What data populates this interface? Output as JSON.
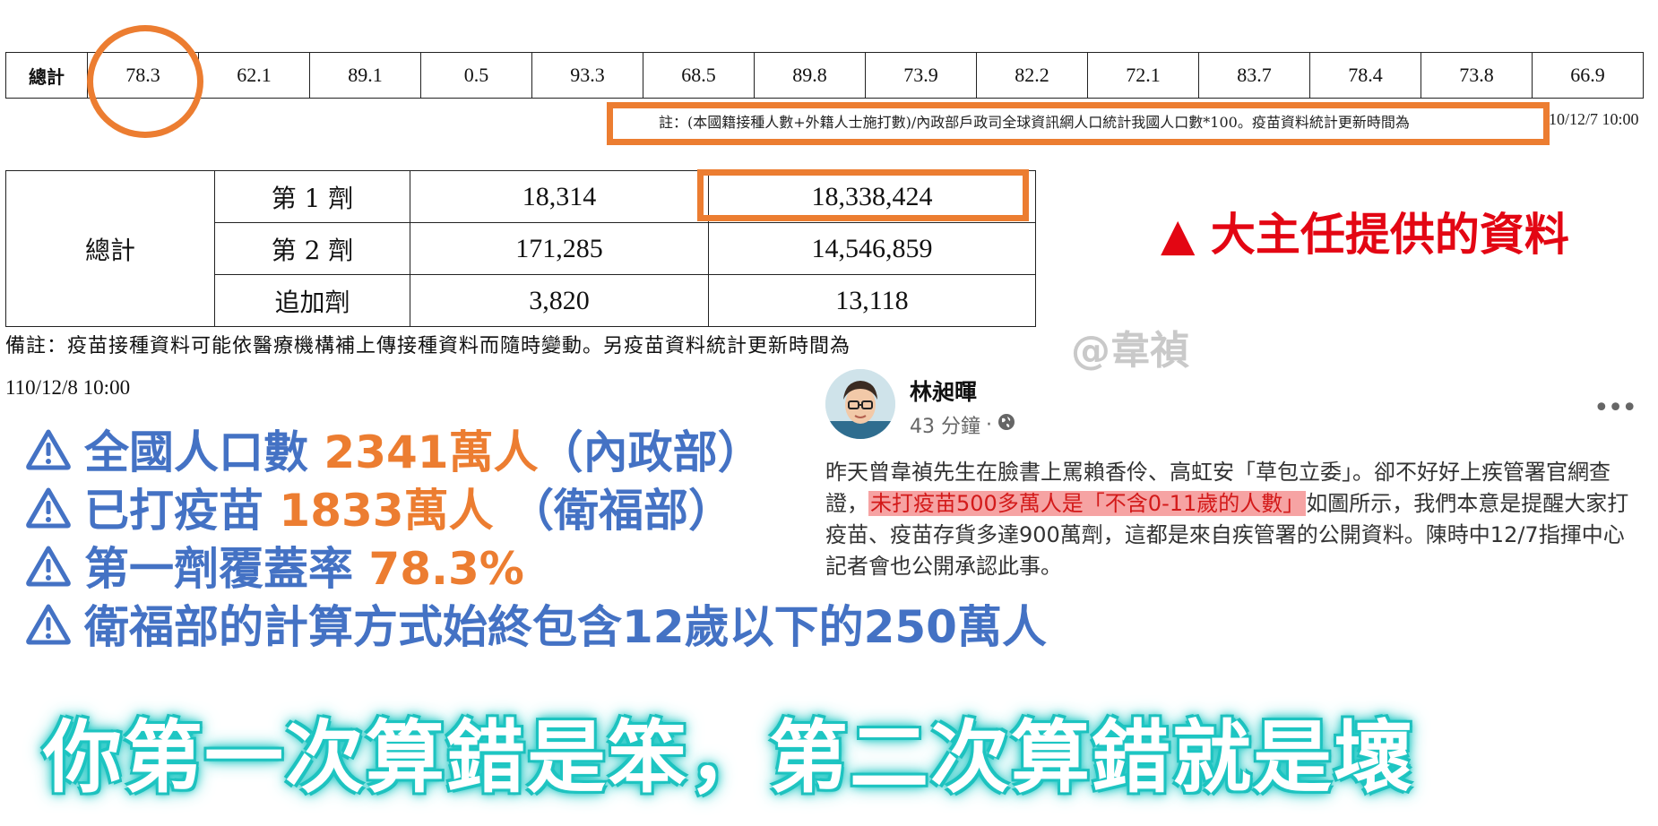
{
  "top_table": {
    "label": "總計",
    "values": [
      "78.3",
      "62.1",
      "89.1",
      "0.5",
      "93.3",
      "68.5",
      "89.8",
      "73.9",
      "82.2",
      "72.1",
      "83.7",
      "78.4",
      "73.8",
      "66.9"
    ],
    "note": "註：(本國籍接種人數+外籍人士施打數)/內政部戶政司全球資訊網人口統計我國人口數*100。疫苗資料統計更新時間為",
    "note_tail": "10/12/7 10:00"
  },
  "vaccine_table": {
    "group": "總計",
    "rows": [
      {
        "dose": "第 1 劑",
        "a": "18,314",
        "b": "18,338,424"
      },
      {
        "dose": "第 2 劑",
        "a": "171,285",
        "b": "14,546,859"
      },
      {
        "dose": "追加劑",
        "a": "3,820",
        "b": "13,118"
      }
    ],
    "remark": "備註：疫苗接種資料可能依醫療機構補上傳接種資料而隨時變動。另疫苗資料統計更新時間為",
    "update_time": "110/12/8 10:00"
  },
  "caption": {
    "text": "▲ 大主任提供的資料",
    "color": "#e30613"
  },
  "watermark": "@韋禎",
  "post": {
    "author": "林昶暉",
    "time": "43 分鐘",
    "separator": "·",
    "more_icon": "more-horizontal-icon",
    "privacy_icon": "globe-icon",
    "body_before": "昨天曾韋禎先生在臉書上罵賴香伶、高虹安「草包立委」。卻不好好上疾管署官網查證，",
    "body_highlight": "未打疫苗500多萬人是「不含0-11歲的人數」",
    "body_after": "如圖所示，我們本意是提醒大家打疫苗、疫苗存貨多達900萬劑，這都是來自疾管署的公開資料。陳時中12/7指揮中心記者會也公開承認此事。"
  },
  "warnings": [
    {
      "icon": "warning-icon",
      "text": "全國人口數 ",
      "highlight": "2341萬人",
      "suffix": "（內政部）"
    },
    {
      "icon": "warning-icon",
      "text": "已打疫苗 ",
      "highlight": "1833萬人",
      "suffix": " （衛福部）"
    },
    {
      "icon": "warning-icon",
      "text": "第一劑覆蓋率 ",
      "highlight": "78.3%",
      "suffix": ""
    },
    {
      "icon": "warning-icon",
      "text": "衛福部的計算方式始終包含12歲以下的250萬人",
      "highlight": "",
      "suffix": ""
    }
  ],
  "slogan": "你第一次算錯是笨，第二次算錯就是壞",
  "colors": {
    "accent_orange": "#ec7d31",
    "accent_blue": "#4472c4",
    "slogan_glow": "#1fc7c4",
    "highlight_bg": "#f6a3a3"
  }
}
